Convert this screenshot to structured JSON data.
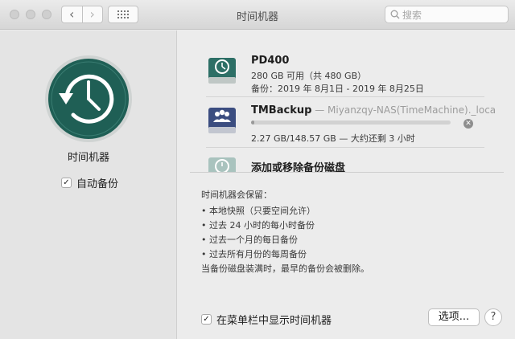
{
  "window": {
    "title": "时间机器"
  },
  "search": {
    "placeholder": "搜索"
  },
  "sidebar": {
    "app_label": "时间机器",
    "auto_backup_label": "自动备份",
    "auto_backup_checked": true
  },
  "disks": [
    {
      "name": "PD400",
      "capacity": "280 GB 可用（共 480 GB）",
      "backup_range": "备份：2019 年 8月1日 - 2019 年 8月25日"
    },
    {
      "name": "TMBackup",
      "url_sep": " — ",
      "url": "Miyanzqy-NAS(TimeMachine)._local",
      "progress_text": "2.27 GB/148.57 GB — 大约还剩 3 小时",
      "progress_fraction": 0.015
    },
    {
      "name": "添加或移除备份磁盘"
    }
  ],
  "keeps": {
    "title": "时间机器会保留：",
    "items": [
      "• 本地快照（只要空间允许）",
      "• 过去 24 小时的每小时备份",
      "• 过去一个月的每日备份",
      "• 过去所有月份的每周备份"
    ],
    "note": "当备份磁盘装满时，最早的备份会被删除。"
  },
  "footer": {
    "menubar_label": "在菜单栏中显示时间机器",
    "menubar_checked": true,
    "options_label": "选项...",
    "help_label": "?"
  },
  "colors": {
    "tm_green": "#1f5f55",
    "disk_green": "#2d6f66",
    "nas_blue": "#3b4d80"
  }
}
